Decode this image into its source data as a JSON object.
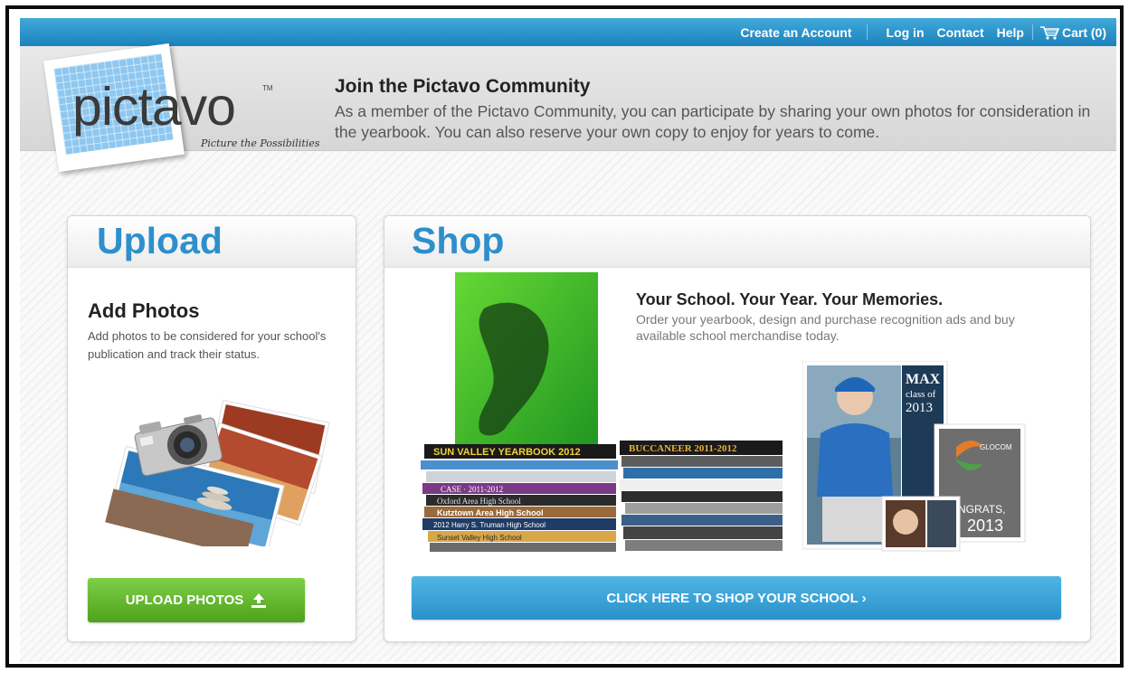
{
  "topnav": {
    "create_account": "Create an Account",
    "log_in": "Log in",
    "contact": "Contact",
    "help": "Help",
    "cart": "Cart (0)"
  },
  "brand": {
    "logo": "pictavo",
    "trademark": "TM",
    "tagline": "Picture the Possibilities"
  },
  "header": {
    "title": "Join the Pictavo Community",
    "description": "As a member of the Pictavo Community, you can participate by sharing your own photos for consideration in the yearbook. You can also reserve your own copy to enjoy for years to come."
  },
  "upload": {
    "heading": "Upload",
    "title": "Add Photos",
    "description": "Add photos to be considered for your school's publication and track their status.",
    "button": "UPLOAD PHOTOS"
  },
  "shop": {
    "heading": "Shop",
    "headline": "Your School. Your Year. Your Memories.",
    "description": "Order your yearbook, design and purchase recognition ads and buy available school merchandise today.",
    "button": "CLICK HERE TO SHOP YOUR SCHOOL ›"
  },
  "yearbooks": {
    "spines": [
      "SUN VALLEY YEARBOOK 2012",
      "BUCCANEER 2011-2012",
      "CASE · 2011-2012",
      "Oxford Area High School",
      "Kutztown Area High School",
      "2012 Harry S. Truman High School",
      "Sunset Valley High School"
    ]
  },
  "ads": {
    "max_name": "MAX",
    "max_line": "class of",
    "max_year": "2013",
    "glocom": "GLOCOM",
    "congrats": "CONGRATS,",
    "congrats_year": "2013"
  },
  "colors": {
    "topbar": "#1c82bd",
    "heading_blue": "#2e8fcb",
    "upload_green": "#4ea21c",
    "shop_blue": "#2a92cc"
  },
  "icons": {
    "cart": "cart-icon",
    "upload": "upload-arrow-icon"
  }
}
